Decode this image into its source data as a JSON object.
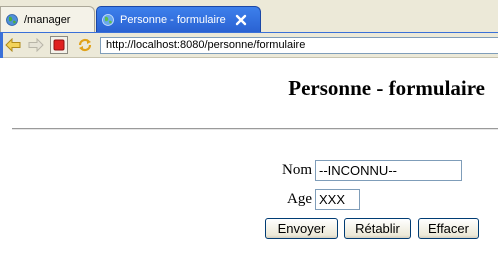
{
  "tabs": [
    {
      "label": "/manager",
      "active": false
    },
    {
      "label": "Personne - formulaire",
      "active": true
    }
  ],
  "address_bar": {
    "url": "http://localhost:8080/personne/formulaire"
  },
  "page": {
    "title": "Personne - formulaire",
    "form": {
      "nom_label": "Nom",
      "nom_value": "--INCONNU--",
      "age_label": "Age",
      "age_value": "XXX"
    },
    "buttons": {
      "submit": "Envoyer",
      "reset": "Rétablir",
      "clear": "Effacer"
    }
  },
  "colors": {
    "active_tab": "#2a62d2",
    "chrome": "#ece9d8",
    "stop": "#e02020"
  },
  "icons": [
    "globe-icon",
    "close-icon",
    "back-arrow-icon",
    "forward-arrow-icon",
    "stop-icon",
    "refresh-icon"
  ]
}
